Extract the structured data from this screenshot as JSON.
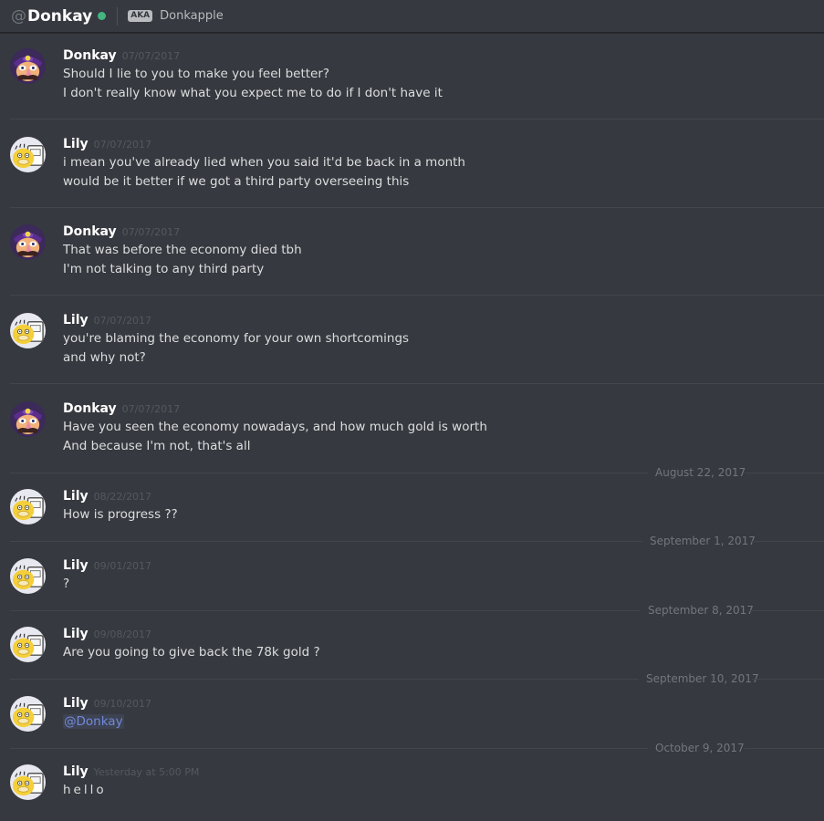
{
  "header": {
    "at_symbol": "@",
    "username": "Donkay",
    "aka_badge": "AKA",
    "aka_name": "Donkapple"
  },
  "messages": [
    {
      "author": "Donkay",
      "timestamp": "07/07/2017",
      "avatar_icon": "waluigi-avatar",
      "lines": [
        "Should I lie to you to make you feel better?",
        "I don't really know what you expect me to do if I don't have it"
      ]
    },
    {
      "author": "Lily",
      "timestamp": "07/07/2017",
      "avatar_icon": "psyduck-avatar",
      "lines": [
        "i mean you've already lied when you said it'd be back in a month",
        "would be it better if we got a third party overseeing this"
      ]
    },
    {
      "author": "Donkay",
      "timestamp": "07/07/2017",
      "avatar_icon": "waluigi-avatar",
      "lines": [
        "That was before the economy died tbh",
        "I'm not talking to any third party"
      ]
    },
    {
      "author": "Lily",
      "timestamp": "07/07/2017",
      "avatar_icon": "psyduck-avatar",
      "lines": [
        "you're blaming the economy for your own shortcomings",
        "and why not?"
      ]
    },
    {
      "author": "Donkay",
      "timestamp": "07/07/2017",
      "avatar_icon": "waluigi-avatar",
      "lines": [
        "Have you seen the economy nowadays, and how much gold is worth",
        "And because I'm not, that's all"
      ]
    },
    {
      "author": "Lily",
      "timestamp": "08/22/2017",
      "avatar_icon": "psyduck-avatar",
      "lines": [
        "How is progress ??"
      ]
    },
    {
      "author": "Lily",
      "timestamp": "09/01/2017",
      "avatar_icon": "psyduck-avatar",
      "lines": [
        "?"
      ]
    },
    {
      "author": "Lily",
      "timestamp": "09/08/2017",
      "avatar_icon": "psyduck-avatar",
      "lines": [
        "Are you going to give back the 78k gold ?"
      ]
    },
    {
      "author": "Lily",
      "timestamp": "09/10/2017",
      "avatar_icon": "psyduck-avatar",
      "lines": [
        "@Donkay"
      ]
    },
    {
      "author": "Lily",
      "timestamp": "Yesterday at 5:00 PM",
      "avatar_icon": "psyduck-avatar",
      "lines": [
        "hello"
      ]
    }
  ],
  "date_dividers": [
    "August 22, 2017",
    "September 1, 2017",
    "September 8, 2017",
    "September 10, 2017",
    "October 9, 2017"
  ],
  "colors": {
    "background": "#36393f",
    "online_status": "#43b581",
    "mention": "#7289da"
  }
}
